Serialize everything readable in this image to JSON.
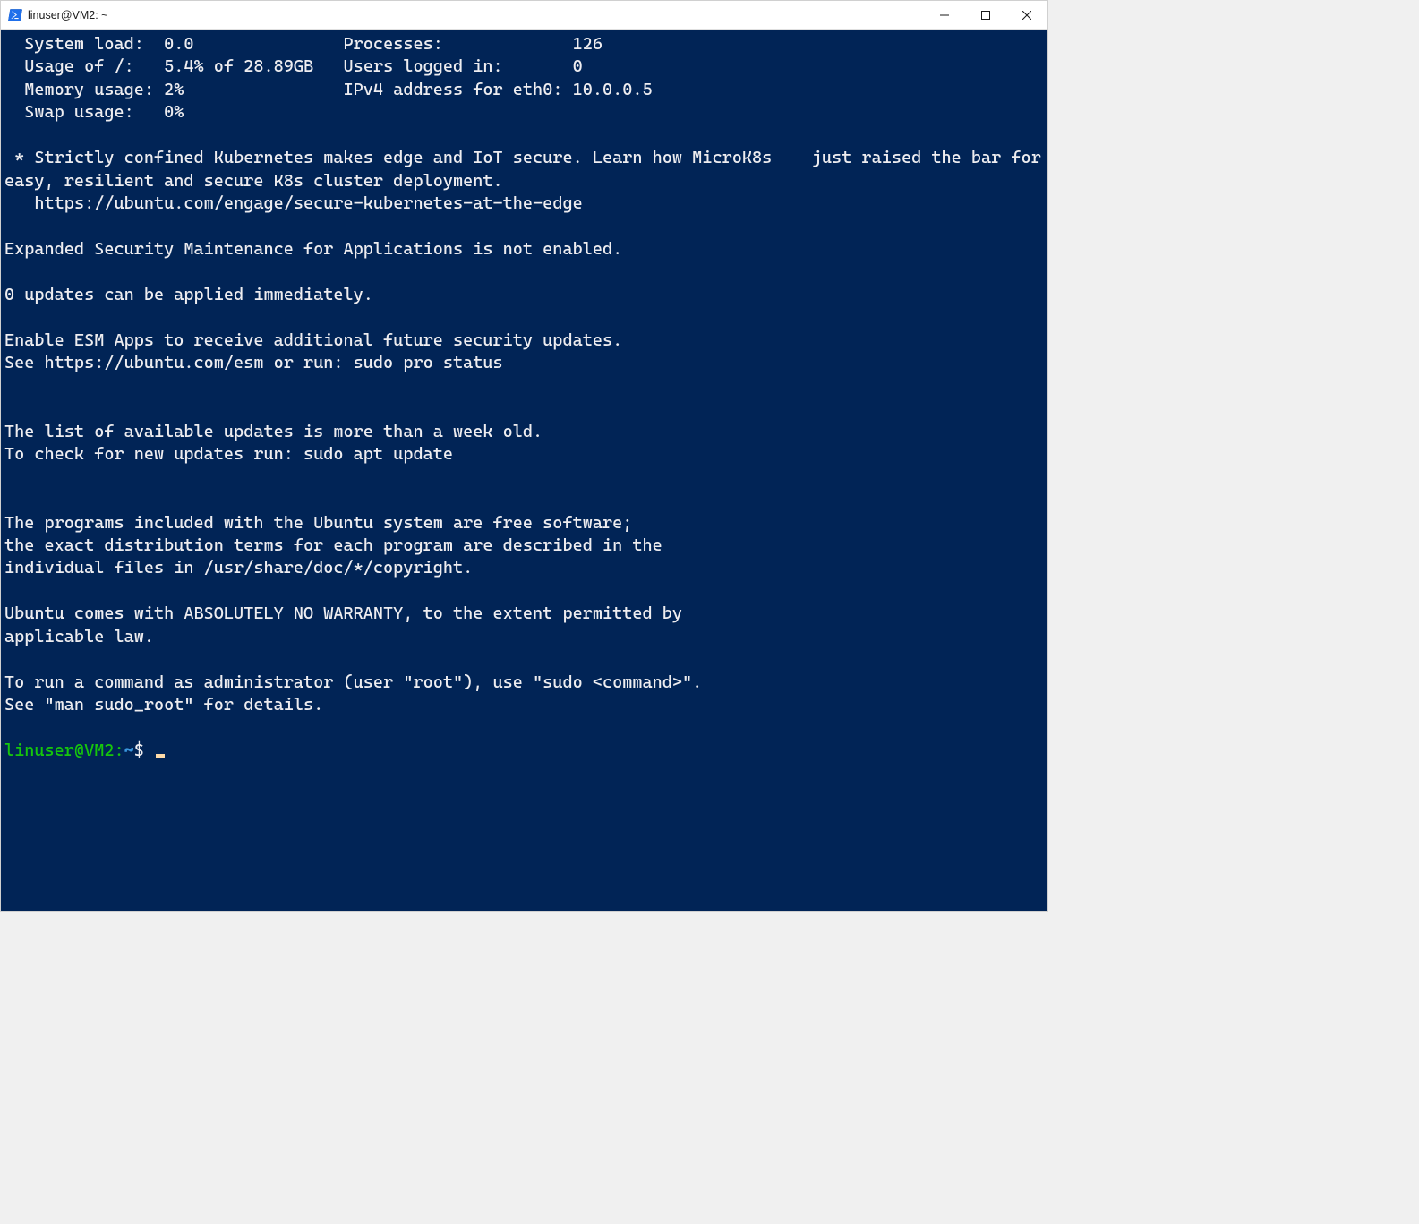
{
  "window": {
    "title": "linuser@VM2: ~"
  },
  "sysinfo": {
    "system_load_label": "System load:",
    "system_load_value": "0.0",
    "processes_label": "Processes:",
    "processes_value": "126",
    "usage_of_label": "Usage of /:",
    "usage_of_value": "5.4% of 28.89GB",
    "users_logged_in_label": "Users logged in:",
    "users_logged_in_value": "0",
    "memory_usage_label": "Memory usage:",
    "memory_usage_value": "2%",
    "ipv4_label": "IPv4 address for eth0:",
    "ipv4_value": "10.0.0.5",
    "swap_usage_label": "Swap usage:",
    "swap_usage_value": "0%"
  },
  "motd": {
    "kube_line1": " * Strictly confined Kubernetes makes edge and IoT secure. Learn how MicroK8s    just raised the bar for easy, resilient and secure K8s cluster deployment.",
    "kube_url": "   https://ubuntu.com/engage/secure-kubernetes-at-the-edge",
    "esm_not_enabled": "Expanded Security Maintenance for Applications is not enabled.",
    "updates_immediate": "0 updates can be applied immediately.",
    "enable_esm": "Enable ESM Apps to receive additional future security updates.",
    "see_esm": "See https://ubuntu.com/esm or run: sudo pro status",
    "updates_old": "The list of available updates is more than a week old.",
    "check_updates": "To check for new updates run: sudo apt update",
    "free_sw1": "The programs included with the Ubuntu system are free software;",
    "free_sw2": "the exact distribution terms for each program are described in the",
    "free_sw3": "individual files in /usr/share/doc/*/copyright.",
    "warranty1": "Ubuntu comes with ABSOLUTELY NO WARRANTY, to the extent permitted by",
    "warranty2": "applicable law.",
    "sudo1": "To run a command as administrator (user \"root\"), use \"sudo <command>\".",
    "sudo2": "See \"man sudo_root\" for details."
  },
  "prompt": {
    "user_host": "linuser@VM2",
    "colon": ":",
    "path": "~",
    "dollar": "$"
  }
}
